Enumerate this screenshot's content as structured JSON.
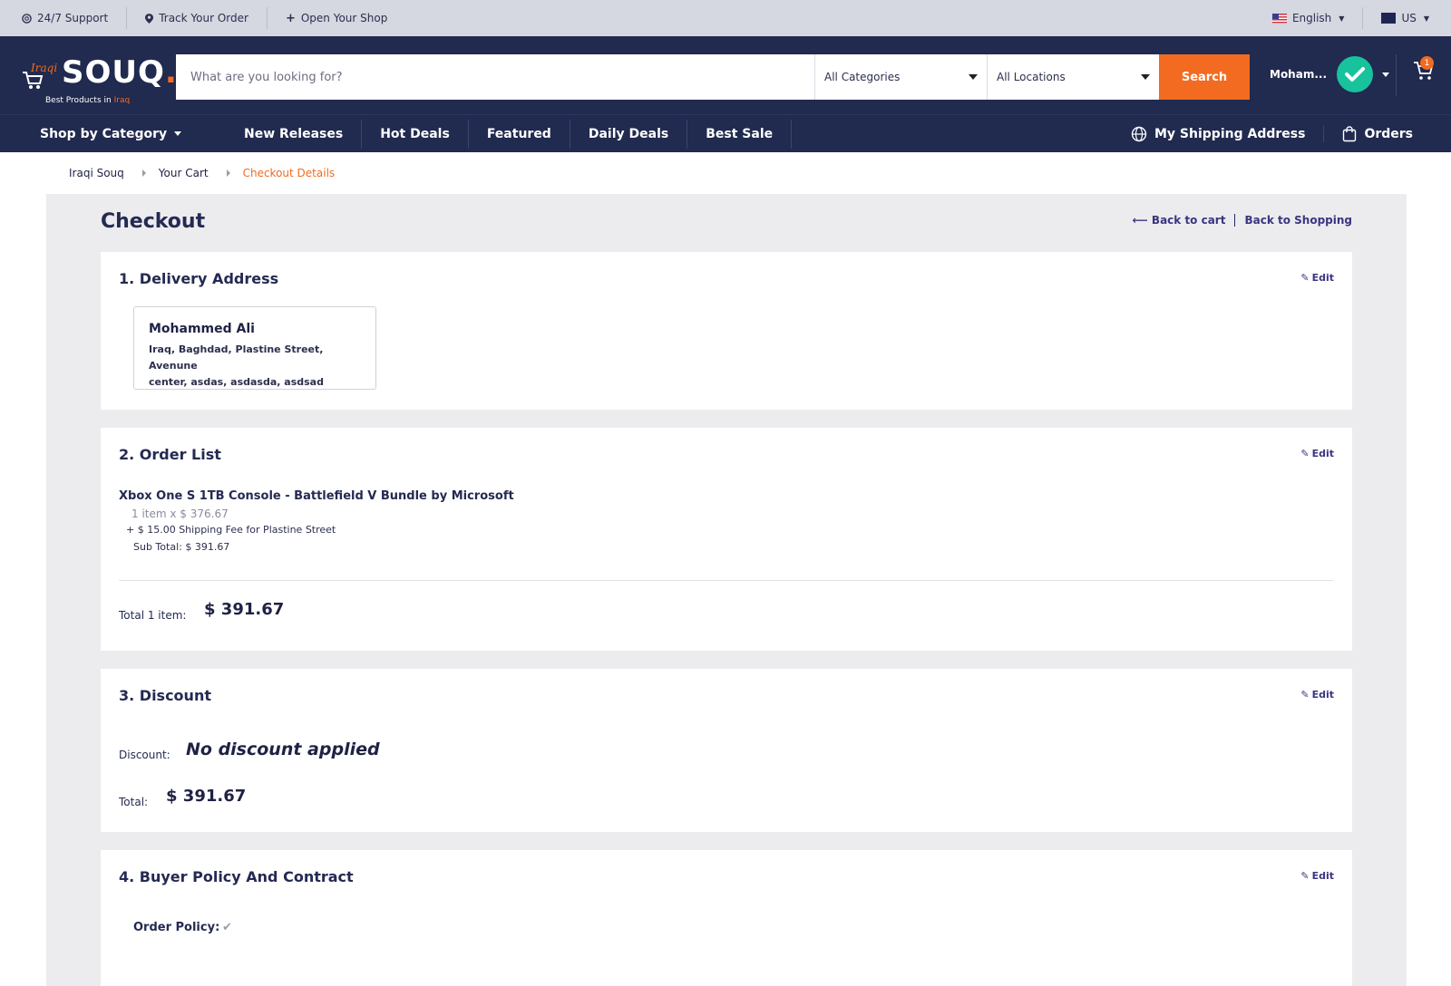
{
  "topbar": {
    "support": "24/7 Support",
    "track": "Track Your Order",
    "open_shop": "Open Your Shop",
    "language": "English",
    "region": "US"
  },
  "header": {
    "logo": {
      "brand_small": "Iraqi",
      "brand": "SOUQ",
      "brand_dot": ".",
      "tagline": "Best Products in",
      "tagline_accent": "Iraq"
    },
    "search": {
      "placeholder": "What are you looking for?",
      "value": "",
      "category": "All Categories",
      "location": "All Locations",
      "button": "Search"
    },
    "user_name": "Moham...",
    "cart_count": "1"
  },
  "nav": {
    "shop_by_category": "Shop by Category",
    "links": [
      "New Releases",
      "Hot Deals",
      "Featured",
      "Daily Deals",
      "Best Sale"
    ],
    "shipping_address": "My Shipping Address",
    "orders": "Orders"
  },
  "breadcrumb": [
    "Iraqi Souq",
    "Your Cart",
    "Checkout Details"
  ],
  "checkout": {
    "title": "Checkout",
    "back_to_cart": "Back to cart",
    "back_to_shopping": "Back to Shopping",
    "edit_label": "Edit",
    "delivery": {
      "title": "1. Delivery Address",
      "name": "Mohammed Ali",
      "line1": "Iraq, Baghdad, Plastine Street, Avenune",
      "line2": "center, asdas, asdasda, asdsad"
    },
    "order_list": {
      "title": "2. Order List",
      "product": "Xbox One S 1TB Console - Battlefield V Bundle by Microsoft",
      "qty": "1 item x $ 376.67",
      "shipping": "+ $ 15.00 Shipping Fee for Plastine Street",
      "subtotal": "Sub Total: $ 391.67",
      "total_label": "Total 1 item:",
      "total_value": "$ 391.67"
    },
    "discount": {
      "title": "3. Discount",
      "label": "Discount:",
      "value": "No discount applied",
      "total_label": "Total:",
      "total_value": "$ 391.67"
    },
    "policy": {
      "title": "4. Buyer Policy And Contract",
      "order_policy_label": "Order Policy:"
    }
  },
  "colors": {
    "header_bg": "#212a4f",
    "accent": "#f26b21",
    "panel_bg": "#ececef",
    "link": "#3a3580",
    "avatar": "#18c29c"
  }
}
